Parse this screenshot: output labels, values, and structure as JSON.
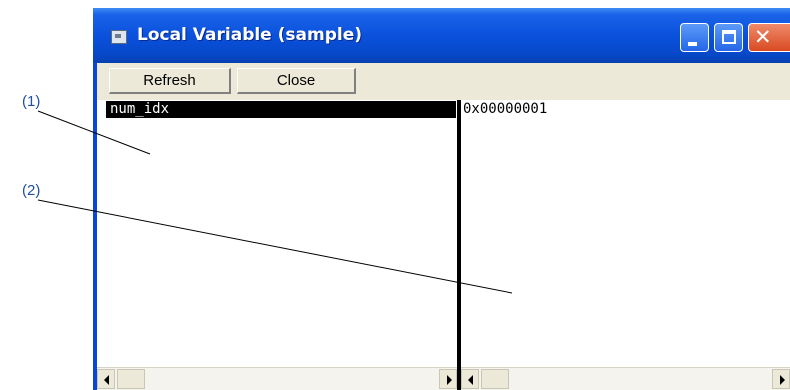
{
  "window": {
    "title": "Local Variable (sample)"
  },
  "toolbar": {
    "refresh_label": "Refresh",
    "close_label": "Close"
  },
  "variables": [
    {
      "name": "num_idx",
      "value": "0x00000001"
    }
  ],
  "callouts": {
    "one": "(1)",
    "two": "(2)"
  },
  "colors": {
    "titlebar": "#0a51dc",
    "selection": "#000000",
    "client": "#ece9d8",
    "callout": "#1f4fa8"
  },
  "icons": [
    "app-icon",
    "minimize-icon",
    "maximize-icon",
    "close-icon",
    "scroll-left-icon",
    "scroll-right-icon"
  ]
}
